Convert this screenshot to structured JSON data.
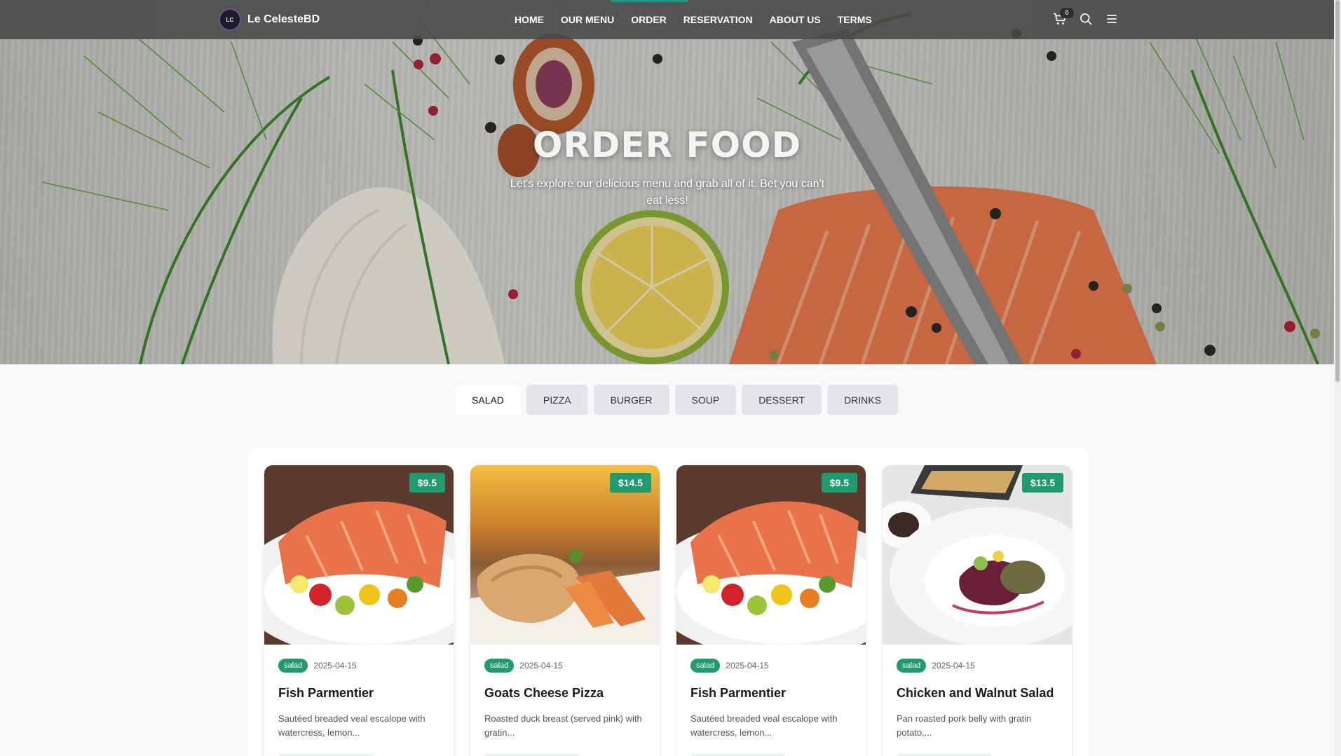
{
  "nav": {
    "logo_text": "LC",
    "brand": "Le CelesteBD",
    "links": [
      "HOME",
      "OUR MENU",
      "ORDER",
      "RESERVATION",
      "ABOUT US",
      "TERMS"
    ],
    "active": "ORDER",
    "cart_count": "6",
    "icons": [
      "cart-icon",
      "search-icon",
      "hamburger-menu-icon"
    ],
    "accent_color": "#1f9b83"
  },
  "hero": {
    "title": "ORDER FOOD",
    "subtitle": "Let's explore our delicious menu and grab all of it. Bet you can't eat less!"
  },
  "tabs": {
    "items": [
      "SALAD",
      "PIZZA",
      "BURGER",
      "SOUP",
      "DESSERT",
      "DRINKS"
    ],
    "active": "SALAD"
  },
  "cards": [
    {
      "price": "$9.5",
      "category": "salad",
      "date": "2025-04-15",
      "title": "Fish Parmentier",
      "description": "Sautéed breaded veal escalope with watercress, lemon...",
      "image": "salmon-plate"
    },
    {
      "price": "$14.5",
      "category": "salad",
      "date": "2025-04-15",
      "title": "Goats Cheese Pizza",
      "description": "Roasted duck breast (served pink) with gratin...",
      "image": "fish-fillet-plate"
    },
    {
      "price": "$9.5",
      "category": "salad",
      "date": "2025-04-15",
      "title": "Fish Parmentier",
      "description": "Sautéed breaded veal escalope with watercress, lemon...",
      "image": "salmon-plate"
    },
    {
      "price": "$13.5",
      "category": "salad",
      "date": "2025-04-15",
      "title": "Chicken and Walnut Salad",
      "description": "Pan roasted pork belly with gratin potato,...",
      "image": "gourmet-salad-plate"
    }
  ],
  "colors": {
    "price_badge": "#1f9b6f",
    "page_background": "#f6f8fa"
  }
}
